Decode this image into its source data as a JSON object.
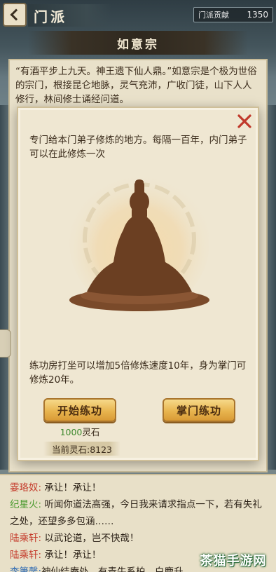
{
  "header": {
    "title": "门派",
    "contribution_label": "门派贡献",
    "contribution_value": "1350"
  },
  "sect": {
    "name": "如意宗",
    "description": "“有酒平步上九天。神王遗下仙人鼎。”如意宗是个极为世俗的宗门，根接昆仑地脉，灵气充沛，广收门徒，山下人人修行，林间修士诵经问道。"
  },
  "modal": {
    "intro": "专门给本门弟子修炼的地方。每隔一百年，内门弟子可以在此修炼一次",
    "effect": "练功房打坐可以增加5倍修炼速度10年，身为掌门可修炼20年。",
    "start_button": "开始练功",
    "master_button": "掌门练功",
    "cost_amount": "1000",
    "cost_unit": "灵石",
    "current_stone": "当前灵石:8123",
    "close_icon": "close-icon",
    "accent_color": "#e8b54f"
  },
  "chat": {
    "lines": [
      {
        "speaker": "霎珞奴:",
        "text": " 承让！承让！",
        "color": "#c43a2a"
      },
      {
        "speaker": "纪星火:",
        "text": " 听闻你道法高强，今日我来请求指点一下，若有失礼之处，还望多多包涵……",
        "color": "#4a9a2e"
      },
      {
        "speaker": "陆乘轩:",
        "text": " 以武论道，岂不快哉！",
        "color": "#c43a2a"
      },
      {
        "speaker": "陆乘轩:",
        "text": " 承让！承让！",
        "color": "#c43a2a"
      },
      {
        "speaker": "李箫馨:",
        "text": "神仙结庵处，有青牛系柏，白鹿升",
        "color": "#2e6ab2"
      }
    ]
  },
  "watermark": "茶猫手游网"
}
